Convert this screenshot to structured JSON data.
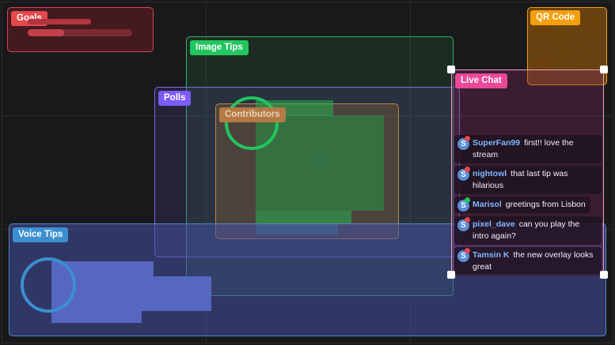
{
  "widgets": {
    "goals": {
      "label": "Goals"
    },
    "qr_code": {
      "label": "QR Code"
    },
    "image_tips": {
      "label": "Image Tips"
    },
    "polls": {
      "label": "Polls"
    },
    "contributors": {
      "label": "Contributors"
    },
    "voice_tips": {
      "label": "Voice Tips"
    },
    "live_chat": {
      "label": "Live Chat"
    }
  },
  "chat": {
    "messages": [
      {
        "user": "SuperFan99",
        "text": "first!! love the stream",
        "avatar_icon": "streamer-s-icon",
        "badge": "red"
      },
      {
        "user": "nightowl",
        "text": "that last tip was hilarious",
        "avatar_icon": "streamer-s-icon",
        "badge": "red"
      },
      {
        "user": "Marisol",
        "text": "greetings from Lisbon",
        "avatar_icon": "streamer-s-icon",
        "badge": "green"
      },
      {
        "user": "pixel_dave",
        "text": "can you play the intro again?",
        "avatar_icon": "streamer-s-icon",
        "badge": "red"
      },
      {
        "user": "Tamsin K",
        "text": "the new overlay looks great",
        "avatar_icon": "streamer-s-icon",
        "badge": "red"
      }
    ]
  },
  "colors": {
    "goals": "#e5484d",
    "qr_code": "#f59e0b",
    "image_tips": "#22c55e",
    "polls": "#7c5cff",
    "contributors": "#b47a45",
    "voice_tips": "#3b8fd1",
    "live_chat": "#ec4899",
    "chat_username": "#7fb6ff"
  }
}
